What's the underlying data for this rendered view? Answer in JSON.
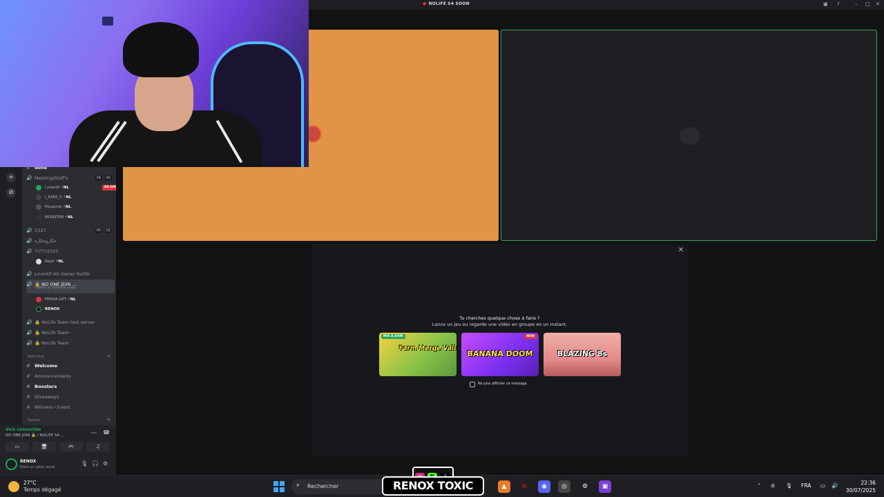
{
  "window": {
    "title": "NOLIFE S4 SOON",
    "buttons": {
      "help": "?",
      "minimize": "–",
      "maximize": "□",
      "close": "✕"
    }
  },
  "rail": {
    "add": "+",
    "explore": "⊘"
  },
  "channels": {
    "top_partial": "done",
    "meeting": {
      "name": "Meeting/Staff's",
      "count_a": "04",
      "count_b": "45"
    },
    "meeting_users": [
      {
        "name": "l.montif",
        "tag": "NL",
        "live": "EN DIRECT"
      },
      {
        "name": "l_ILYAS_S",
        "tag": "NL"
      },
      {
        "name": "Picasmie",
        "tag": "NL"
      },
      {
        "name": "MONSTER",
        "tag": "NL"
      }
    ],
    "c1337": {
      "name": "1337",
      "count_a": "00",
      "count_b": "03"
    },
    "arabic": "حكاروحكاره",
    "c2025": "??/??/2025",
    "c2025_user": {
      "name": "Reyk",
      "tag": "NL"
    },
    "owner": "Lmontif Ait Owner Nolife",
    "no_one_join": "NO ONE JOIN ...",
    "no_one_join_sub": "Définir un statut de salon",
    "voice_users": [
      {
        "name": "FERDA GPT",
        "tag": "NL"
      },
      {
        "name": "RENOX"
      }
    ],
    "team_test": "NoLife Team test server",
    "team1": "NoLife Team",
    "team2": "NoLife Team",
    "main_hub": "Main Hub",
    "welcome": "Welcome",
    "announcements": "Announcements",
    "boosters": "Boosters",
    "giveaways": "Giveaways",
    "winners": "Winners・Event",
    "partner": "Partner"
  },
  "voice_panel": {
    "status": "Voix connectée",
    "channel": "NO ONE JOIN 🔒 / NOLIFE S4 ..."
  },
  "user_panel": {
    "name": "RENOX",
    "status": "Dans un salon vocal"
  },
  "activity": {
    "question": "Tu cherches quelque chose à faire ?",
    "subtitle": "Lance un jeu ou regarde une vidéo en groupe en un instant.",
    "cards": [
      {
        "name": "Farm Merge Valley",
        "tag": "MIS À JOUR",
        "color": "#8bc34a"
      },
      {
        "name": "BANANA DOOM",
        "tag": "NEW",
        "color": "#9b3fd9"
      },
      {
        "name": "BLAZING 8s",
        "tag": "",
        "color": "#e9a0a0"
      }
    ],
    "checkbox_label": "Ne plus afficher ce message."
  },
  "taskbar": {
    "temp": "27°C",
    "condition": "Temps dégagé",
    "search_placeholder": "Rechercher",
    "lang": "FRA",
    "time": "22:36",
    "date": "30/07/2025"
  },
  "overlay": {
    "brand": "RENOX TOXIC"
  },
  "colors": {
    "accent": "#5865f2",
    "online": "#23a55a",
    "live": "#da373c",
    "orange_tile": "#e29446"
  }
}
